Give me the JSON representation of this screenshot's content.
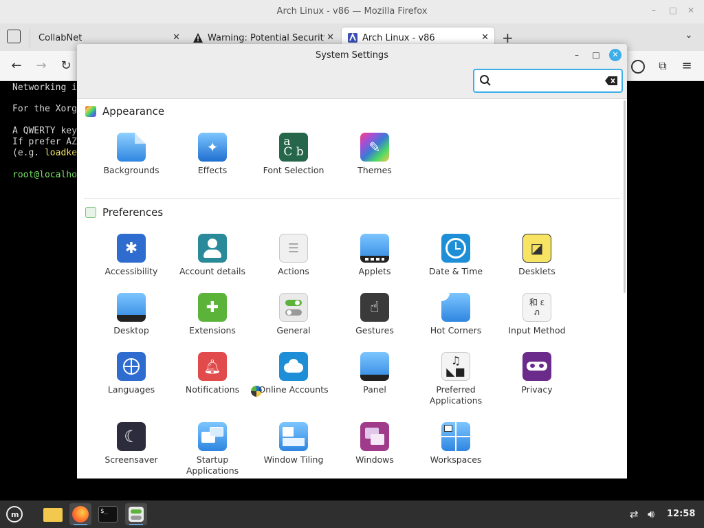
{
  "firefox": {
    "title": "Arch Linux - v86 — Mozilla Firefox",
    "tabs": [
      {
        "label": "CollabNet"
      },
      {
        "label": "Warning: Potential Security"
      },
      {
        "label": "Arch Linux - v86"
      }
    ],
    "new_tab": "+"
  },
  "terminal": {
    "lines": [
      "Networking i",
      "For the Xorg",
      "A QWERTY key",
      "If prefer AZ",
      "(e.g. ",
      "loadke",
      "root@localho"
    ]
  },
  "settings": {
    "title": "System Settings",
    "search": {
      "value": "",
      "placeholder": ""
    },
    "sections": [
      {
        "title": "Appearance",
        "items": [
          {
            "label": "Backgrounds",
            "icon": "backgrounds-icon"
          },
          {
            "label": "Effects",
            "icon": "effects-icon"
          },
          {
            "label": "Font Selection",
            "icon": "font-selection-icon"
          },
          {
            "label": "Themes",
            "icon": "themes-icon"
          }
        ]
      },
      {
        "title": "Preferences",
        "items": [
          {
            "label": "Accessibility",
            "icon": "accessibility-icon"
          },
          {
            "label": "Account details",
            "icon": "account-details-icon"
          },
          {
            "label": "Actions",
            "icon": "actions-icon"
          },
          {
            "label": "Applets",
            "icon": "applets-icon"
          },
          {
            "label": "Date & Time",
            "icon": "date-time-icon"
          },
          {
            "label": "Desklets",
            "icon": "desklets-icon"
          },
          {
            "label": "Desktop",
            "icon": "desktop-icon"
          },
          {
            "label": "Extensions",
            "icon": "extensions-icon"
          },
          {
            "label": "General",
            "icon": "general-icon"
          },
          {
            "label": "Gestures",
            "icon": "gestures-icon"
          },
          {
            "label": "Hot Corners",
            "icon": "hot-corners-icon"
          },
          {
            "label": "Input Method",
            "icon": "input-method-icon"
          },
          {
            "label": "Languages",
            "icon": "languages-icon"
          },
          {
            "label": "Notifications",
            "icon": "notifications-icon"
          },
          {
            "label": "Online Accounts",
            "icon": "online-accounts-icon"
          },
          {
            "label": "Panel",
            "icon": "panel-icon"
          },
          {
            "label": "Preferred Applications",
            "icon": "preferred-applications-icon"
          },
          {
            "label": "Privacy",
            "icon": "privacy-icon"
          },
          {
            "label": "Screensaver",
            "icon": "screensaver-icon"
          },
          {
            "label": "Startup Applications",
            "icon": "startup-applications-icon"
          },
          {
            "label": "Window Tiling",
            "icon": "window-tiling-icon"
          },
          {
            "label": "Windows",
            "icon": "windows-icon"
          },
          {
            "label": "Workspaces",
            "icon": "workspaces-icon"
          }
        ]
      }
    ]
  },
  "taskbar": {
    "clock": "12:58",
    "apps": [
      "menu-icon",
      "files-icon",
      "firefox-icon",
      "terminal-icon",
      "settings-icon"
    ]
  },
  "colors": {
    "accent": "#3daee9",
    "terminal_bg": "#000000",
    "terminal_green": "#7ee36a",
    "terminal_yellow": "#f3e26a"
  }
}
